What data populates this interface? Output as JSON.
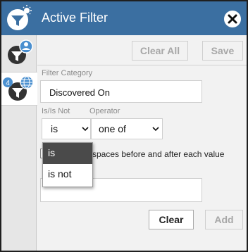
{
  "window": {
    "title": "Active Filter"
  },
  "toolbar": {
    "clear_all_label": "Clear All",
    "save_label": "Save"
  },
  "filter": {
    "category_label": "Filter Category",
    "category_value": "Discovered On",
    "is_not_label": "Is/Is Not",
    "is_not_value": "is",
    "operator_label": "Operator",
    "operator_value": "one of",
    "trim_checkbox_label": "spaces before and after each value",
    "trim_checked": false
  },
  "is_not_dropdown": {
    "options": [
      "is",
      "is not"
    ],
    "selected": "is"
  },
  "actions": {
    "clear_label": "Clear",
    "add_label": "Add"
  },
  "rail": {
    "badge_count": "4"
  },
  "icons": {
    "title": "filter-sun-icon",
    "close": "close-icon",
    "tab_one": "filter-user-icon",
    "tab_two": "filter-globe-icon",
    "chevron": "chevron-down-icon"
  },
  "colors": {
    "titlebar": "#3b6fa1",
    "rail": "#e6e6e6",
    "badge": "#4a8fcf",
    "dropdown_selected": "#4a4a4a",
    "disabled_text": "#a7a7a7"
  }
}
